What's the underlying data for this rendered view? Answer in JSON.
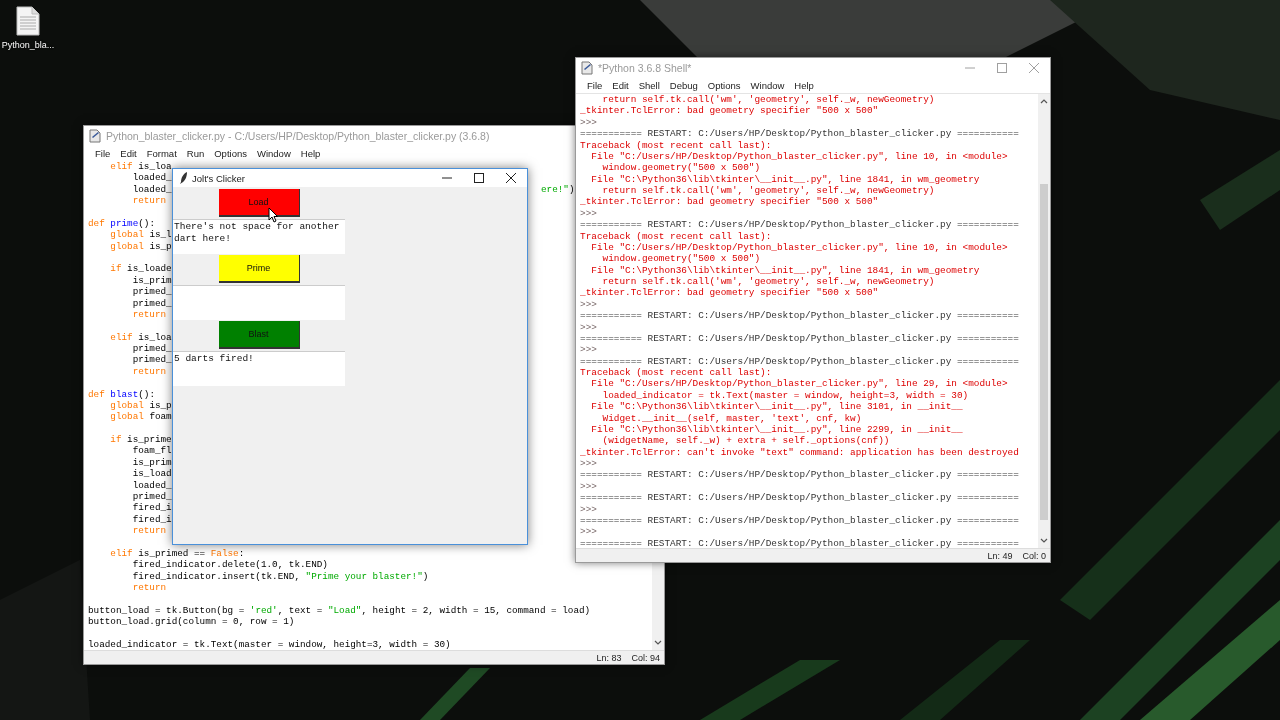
{
  "desktop_icon": {
    "label": "Python_bla..."
  },
  "editor": {
    "title": "Python_blaster_clicker.py - C:/Users/HP/Desktop/Python_blaster_clicker.py (3.6.8)",
    "menu": [
      "File",
      "Edit",
      "Format",
      "Run",
      "Options",
      "Window",
      "Help"
    ],
    "lines": [
      {
        "kind": "code",
        "segments": [
          {
            "kind": "keyword",
            "text": "    elif"
          },
          {
            "kind": "plain",
            "text": " is_loa"
          }
        ]
      },
      {
        "kind": "code",
        "segments": [
          {
            "kind": "plain",
            "text": "        loaded_"
          }
        ]
      },
      {
        "kind": "code",
        "segments": [
          {
            "kind": "plain",
            "text": "        loaded_"
          }
        ],
        "tail": [
          {
            "kind": "string",
            "text": "ere!\""
          },
          {
            "kind": "plain",
            "text": ")"
          }
        ]
      },
      {
        "kind": "code",
        "segments": [
          {
            "kind": "keyword",
            "text": "        return"
          }
        ]
      },
      {
        "kind": "blank"
      },
      {
        "kind": "code",
        "segments": [
          {
            "kind": "keyword",
            "text": "def "
          },
          {
            "kind": "definition",
            "text": "prime"
          },
          {
            "kind": "plain",
            "text": "():"
          }
        ]
      },
      {
        "kind": "code",
        "segments": [
          {
            "kind": "keyword",
            "text": "    global"
          },
          {
            "kind": "plain",
            "text": " is_l"
          }
        ]
      },
      {
        "kind": "code",
        "segments": [
          {
            "kind": "keyword",
            "text": "    global"
          },
          {
            "kind": "plain",
            "text": " is_p"
          }
        ]
      },
      {
        "kind": "blank"
      },
      {
        "kind": "code",
        "segments": [
          {
            "kind": "keyword",
            "text": "    if"
          },
          {
            "kind": "plain",
            "text": " is_loade"
          }
        ]
      },
      {
        "kind": "code",
        "segments": [
          {
            "kind": "plain",
            "text": "        is_prim"
          }
        ]
      },
      {
        "kind": "code",
        "segments": [
          {
            "kind": "plain",
            "text": "        primed_"
          }
        ]
      },
      {
        "kind": "code",
        "segments": [
          {
            "kind": "plain",
            "text": "        primed_"
          }
        ]
      },
      {
        "kind": "code",
        "segments": [
          {
            "kind": "keyword",
            "text": "        return"
          }
        ]
      },
      {
        "kind": "blank"
      },
      {
        "kind": "code",
        "segments": [
          {
            "kind": "keyword",
            "text": "    elif"
          },
          {
            "kind": "plain",
            "text": " is_loa"
          }
        ]
      },
      {
        "kind": "code",
        "segments": [
          {
            "kind": "plain",
            "text": "        primed_"
          }
        ]
      },
      {
        "kind": "code",
        "segments": [
          {
            "kind": "plain",
            "text": "        primed_"
          }
        ]
      },
      {
        "kind": "code",
        "segments": [
          {
            "kind": "keyword",
            "text": "        return"
          }
        ]
      },
      {
        "kind": "blank"
      },
      {
        "kind": "code",
        "segments": [
          {
            "kind": "keyword",
            "text": "def "
          },
          {
            "kind": "definition",
            "text": "blast"
          },
          {
            "kind": "plain",
            "text": "():"
          }
        ]
      },
      {
        "kind": "code",
        "segments": [
          {
            "kind": "keyword",
            "text": "    global"
          },
          {
            "kind": "plain",
            "text": " is_p"
          }
        ]
      },
      {
        "kind": "code",
        "segments": [
          {
            "kind": "keyword",
            "text": "    global"
          },
          {
            "kind": "plain",
            "text": " foam"
          }
        ]
      },
      {
        "kind": "blank"
      },
      {
        "kind": "code",
        "segments": [
          {
            "kind": "keyword",
            "text": "    if"
          },
          {
            "kind": "plain",
            "text": " is_prime"
          }
        ]
      },
      {
        "kind": "code",
        "segments": [
          {
            "kind": "plain",
            "text": "        foam_fl"
          }
        ]
      },
      {
        "kind": "code",
        "segments": [
          {
            "kind": "plain",
            "text": "        is_prim"
          }
        ]
      },
      {
        "kind": "code",
        "segments": [
          {
            "kind": "plain",
            "text": "        is_load"
          }
        ]
      },
      {
        "kind": "code",
        "segments": [
          {
            "kind": "plain",
            "text": "        loaded_"
          }
        ]
      },
      {
        "kind": "code",
        "segments": [
          {
            "kind": "plain",
            "text": "        primed_"
          }
        ]
      },
      {
        "kind": "code",
        "segments": [
          {
            "kind": "plain",
            "text": "        fired_i"
          }
        ]
      },
      {
        "kind": "code",
        "segments": [
          {
            "kind": "plain",
            "text": "        fired_i"
          }
        ]
      },
      {
        "kind": "code",
        "segments": [
          {
            "kind": "keyword",
            "text": "        return"
          }
        ]
      },
      {
        "kind": "blank"
      },
      {
        "kind": "code",
        "segments": [
          {
            "kind": "keyword",
            "text": "    elif"
          },
          {
            "kind": "plain",
            "text": " is_primed == "
          },
          {
            "kind": "keyword",
            "text": "False"
          },
          {
            "kind": "plain",
            "text": ":"
          }
        ]
      },
      {
        "kind": "code",
        "segments": [
          {
            "kind": "plain",
            "text": "        fired_indicator.delete(1.0, tk.END)"
          }
        ]
      },
      {
        "kind": "code",
        "segments": [
          {
            "kind": "plain",
            "text": "        fired_indicator.insert(tk.END, "
          },
          {
            "kind": "string",
            "text": "\"Prime your blaster!\""
          },
          {
            "kind": "plain",
            "text": ")"
          }
        ]
      },
      {
        "kind": "code",
        "segments": [
          {
            "kind": "keyword",
            "text": "        return"
          }
        ]
      },
      {
        "kind": "blank"
      },
      {
        "kind": "code",
        "segments": [
          {
            "kind": "plain",
            "text": "button_load = tk.Button(bg = "
          },
          {
            "kind": "string",
            "text": "'red'"
          },
          {
            "kind": "plain",
            "text": ", text = "
          },
          {
            "kind": "string",
            "text": "\"Load\""
          },
          {
            "kind": "plain",
            "text": ", height = 2, width = 15, command = load)"
          }
        ]
      },
      {
        "kind": "code",
        "segments": [
          {
            "kind": "plain",
            "text": "button_load.grid(column = 0, row = 1)"
          }
        ]
      },
      {
        "kind": "blank"
      },
      {
        "kind": "code",
        "segments": [
          {
            "kind": "plain",
            "text": "loaded_indicator = tk.Text(master = window, height=3, width = 30)"
          }
        ]
      }
    ],
    "status": {
      "line": "Ln: 83",
      "column": "Col: 94"
    }
  },
  "shell": {
    "title": "*Python 3.6.8 Shell*",
    "menu": [
      "File",
      "Edit",
      "Shell",
      "Debug",
      "Options",
      "Window",
      "Help"
    ],
    "lines": [
      {
        "kind": "error",
        "text": "    return self.tk.call('wm', 'geometry', self._w, newGeometry)"
      },
      {
        "kind": "error",
        "text": "_tkinter.TclError: bad geometry specifier \"500 x 500\""
      },
      {
        "kind": "prompt",
        "text": ">>>"
      },
      {
        "kind": "restart",
        "text": "=========== RESTART: C:/Users/HP/Desktop/Python_blaster_clicker.py ==========="
      },
      {
        "kind": "error",
        "text": "Traceback (most recent call last):"
      },
      {
        "kind": "error",
        "text": "  File \"C:/Users/HP/Desktop/Python_blaster_clicker.py\", line 10, in <module>"
      },
      {
        "kind": "error",
        "text": "    window.geometry(\"500 x 500\")"
      },
      {
        "kind": "error",
        "text": "  File \"C:\\Python36\\lib\\tkinter\\__init__.py\", line 1841, in wm_geometry"
      },
      {
        "kind": "error",
        "text": "    return self.tk.call('wm', 'geometry', self._w, newGeometry)"
      },
      {
        "kind": "error",
        "text": "_tkinter.TclError: bad geometry specifier \"500 x 500\""
      },
      {
        "kind": "prompt",
        "text": ">>>"
      },
      {
        "kind": "restart",
        "text": "=========== RESTART: C:/Users/HP/Desktop/Python_blaster_clicker.py ==========="
      },
      {
        "kind": "error",
        "text": "Traceback (most recent call last):"
      },
      {
        "kind": "error",
        "text": "  File \"C:/Users/HP/Desktop/Python_blaster_clicker.py\", line 10, in <module>"
      },
      {
        "kind": "error",
        "text": "    window.geometry(\"500 x 500\")"
      },
      {
        "kind": "error",
        "text": "  File \"C:\\Python36\\lib\\tkinter\\__init__.py\", line 1841, in wm_geometry"
      },
      {
        "kind": "error",
        "text": "    return self.tk.call('wm', 'geometry', self._w, newGeometry)"
      },
      {
        "kind": "error",
        "text": "_tkinter.TclError: bad geometry specifier \"500 x 500\""
      },
      {
        "kind": "prompt",
        "text": ">>>"
      },
      {
        "kind": "restart",
        "text": "=========== RESTART: C:/Users/HP/Desktop/Python_blaster_clicker.py ==========="
      },
      {
        "kind": "prompt",
        "text": ">>>"
      },
      {
        "kind": "restart",
        "text": "=========== RESTART: C:/Users/HP/Desktop/Python_blaster_clicker.py ==========="
      },
      {
        "kind": "prompt",
        "text": ">>>"
      },
      {
        "kind": "restart",
        "text": "=========== RESTART: C:/Users/HP/Desktop/Python_blaster_clicker.py ==========="
      },
      {
        "kind": "error",
        "text": "Traceback (most recent call last):"
      },
      {
        "kind": "error",
        "text": "  File \"C:/Users/HP/Desktop/Python_blaster_clicker.py\", line 29, in <module>"
      },
      {
        "kind": "error",
        "text": "    loaded_indicator = tk.Text(master = window, height=3, width = 30)"
      },
      {
        "kind": "error",
        "text": "  File \"C:\\Python36\\lib\\tkinter\\__init__.py\", line 3101, in __init__"
      },
      {
        "kind": "error",
        "text": "    Widget.__init__(self, master, 'text', cnf, kw)"
      },
      {
        "kind": "error",
        "text": "  File \"C:\\Python36\\lib\\tkinter\\__init__.py\", line 2299, in __init__"
      },
      {
        "kind": "error",
        "text": "    (widgetName, self._w) + extra + self._options(cnf))"
      },
      {
        "kind": "error",
        "text": "_tkinter.TclError: can't invoke \"text\" command: application has been destroyed"
      },
      {
        "kind": "prompt",
        "text": ">>>"
      },
      {
        "kind": "restart",
        "text": "=========== RESTART: C:/Users/HP/Desktop/Python_blaster_clicker.py ==========="
      },
      {
        "kind": "prompt",
        "text": ">>>"
      },
      {
        "kind": "restart",
        "text": "=========== RESTART: C:/Users/HP/Desktop/Python_blaster_clicker.py ==========="
      },
      {
        "kind": "prompt",
        "text": ">>>"
      },
      {
        "kind": "restart",
        "text": "=========== RESTART: C:/Users/HP/Desktop/Python_blaster_clicker.py ==========="
      },
      {
        "kind": "prompt",
        "text": ">>>"
      },
      {
        "kind": "restart",
        "text": "=========== RESTART: C:/Users/HP/Desktop/Python_blaster_clicker.py ==========="
      }
    ],
    "status": {
      "line": "Ln: 49",
      "column": "Col: 0"
    }
  },
  "app": {
    "title": "Jolt's Clicker",
    "rows": [
      {
        "button": {
          "label": "Load",
          "color": "#ff0000"
        },
        "output": "There's not space for another dart here!"
      },
      {
        "button": {
          "label": "Prime",
          "color": "#ffff00"
        }
      },
      {
        "button": {
          "label": "Blast",
          "color": "#008000"
        },
        "output": "5 darts fired!"
      }
    ]
  }
}
